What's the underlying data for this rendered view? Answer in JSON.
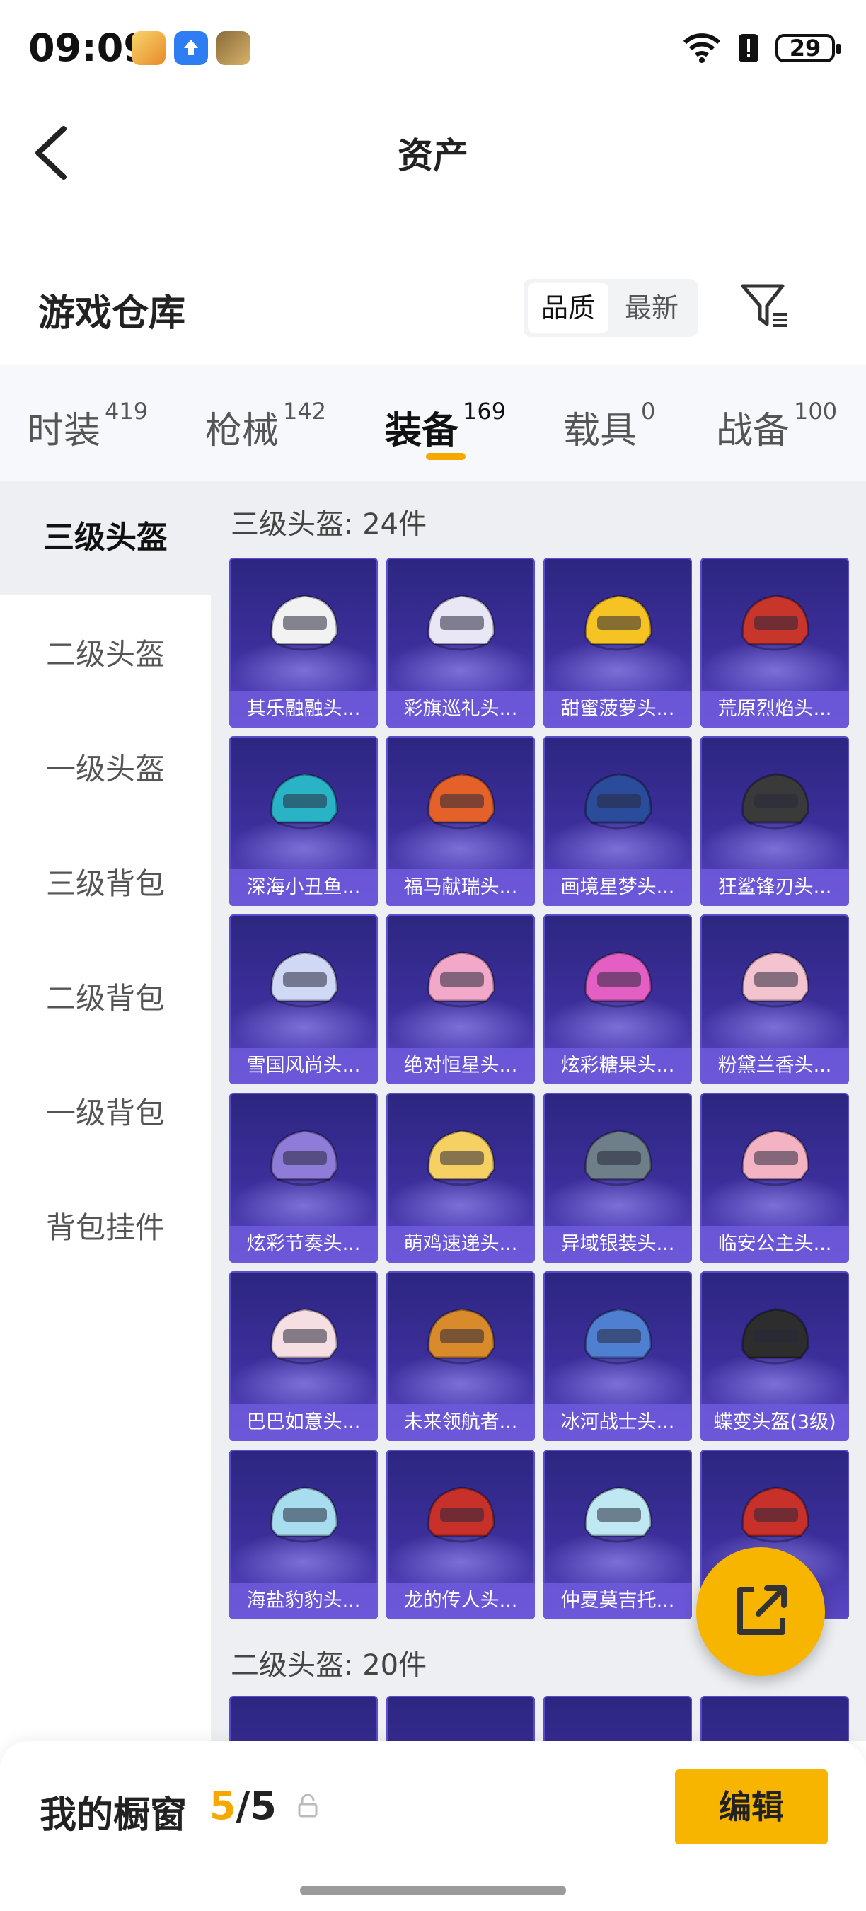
{
  "status_bar": {
    "time": "09:09",
    "battery": "29"
  },
  "header": {
    "title": "资产"
  },
  "section": {
    "title": "游戏仓库"
  },
  "sort": {
    "options": [
      "品质",
      "最新"
    ],
    "selected": "品质"
  },
  "tabs": [
    {
      "label": "时装",
      "count": "419"
    },
    {
      "label": "枪械",
      "count": "142"
    },
    {
      "label": "装备",
      "count": "169",
      "active": true
    },
    {
      "label": "载具",
      "count": "0"
    },
    {
      "label": "战备",
      "count": "100"
    }
  ],
  "side_nav": [
    "三级头盔",
    "二级头盔",
    "一级头盔",
    "三级背包",
    "二级背包",
    "一级背包",
    "背包挂件"
  ],
  "groups": [
    {
      "title": "三级头盔: 24件"
    },
    {
      "title": "二级头盔: 20件"
    }
  ],
  "items": [
    {
      "name": "其乐融融头...",
      "color": "#f2f2f2"
    },
    {
      "name": "彩旗巡礼头...",
      "color": "#e9e6f5"
    },
    {
      "name": "甜蜜菠萝头...",
      "color": "#f5c323"
    },
    {
      "name": "荒原烈焰头...",
      "color": "#c8352a"
    },
    {
      "name": "深海小丑鱼...",
      "color": "#2ab3c6"
    },
    {
      "name": "福马献瑞头...",
      "color": "#e4622a"
    },
    {
      "name": "画境星梦头...",
      "color": "#2a4c9a"
    },
    {
      "name": "狂鲨锋刃头...",
      "color": "#3a3a3a"
    },
    {
      "name": "雪国风尚头...",
      "color": "#cfd8f5"
    },
    {
      "name": "绝对恒星头...",
      "color": "#f2a8c8"
    },
    {
      "name": "炫彩糖果头...",
      "color": "#e35fc4"
    },
    {
      "name": "粉黛兰香头...",
      "color": "#f3c3cf"
    },
    {
      "name": "炫彩节奏头...",
      "color": "#8f7bd8"
    },
    {
      "name": "萌鸡速递头...",
      "color": "#f5d063"
    },
    {
      "name": "异域银装头...",
      "color": "#6e7f8a"
    },
    {
      "name": "临安公主头...",
      "color": "#f4b3c3"
    },
    {
      "name": "巴巴如意头...",
      "color": "#f6dfe2"
    },
    {
      "name": "未来领航者...",
      "color": "#d98a2a"
    },
    {
      "name": "冰河战士头...",
      "color": "#4f7fd1"
    },
    {
      "name": "蝶变头盔(3级)",
      "color": "#2d2d2d"
    },
    {
      "name": "海盐豹豹头...",
      "color": "#a8ddf0"
    },
    {
      "name": "龙的传人头...",
      "color": "#c8302a"
    },
    {
      "name": "仲夏莫吉托...",
      "color": "#bfe8f2"
    },
    {
      "name": "",
      "color": "#c8302a"
    }
  ],
  "bottom_bar": {
    "title": "我的橱窗",
    "current": "5",
    "total": "/5",
    "edit_label": "编辑"
  }
}
